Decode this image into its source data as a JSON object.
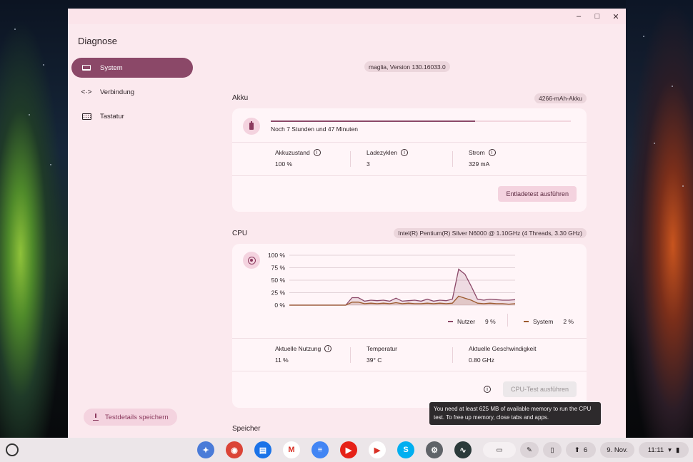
{
  "window": {
    "app_title": "Diagnose",
    "controls": {
      "minimize": "–",
      "maximize": "□",
      "close": "✕"
    }
  },
  "nav": {
    "items": [
      {
        "label": "System",
        "icon": "laptop-icon",
        "active": true
      },
      {
        "label": "Verbindung",
        "icon": "connection-icon",
        "active": false
      },
      {
        "label": "Tastatur",
        "icon": "keyboard-icon",
        "active": false
      }
    ],
    "save_label": "Testdetails speichern"
  },
  "version": "maglia, Version 130.16033.0",
  "battery": {
    "title": "Akku",
    "chip": "4266-mAh-Akku",
    "charge_fraction": 0.68,
    "remaining": "Noch 7 Stunden und 47 Minuten",
    "stats": [
      {
        "label": "Akkuzustand",
        "value": "100 %"
      },
      {
        "label": "Ladezyklen",
        "value": "3"
      },
      {
        "label": "Strom",
        "value": "329 mA"
      }
    ],
    "button": "Entladetest ausführen"
  },
  "cpu": {
    "title": "CPU",
    "chip": "Intel(R) Pentium(R) Silver N6000 @ 1.10GHz (4 Threads, 3.30 GHz)",
    "legend": [
      {
        "name": "Nutzer",
        "value": "9 %",
        "color": "#8b4868"
      },
      {
        "name": "System",
        "value": "2 %",
        "color": "#9c5a2e"
      }
    ],
    "stats": [
      {
        "label": "Aktuelle Nutzung",
        "value": "11 %"
      },
      {
        "label": "Temperatur",
        "value": "39° C"
      },
      {
        "label": "Aktuelle Geschwindigkeit",
        "value": "0.80 GHz"
      }
    ],
    "button": "CPU-Test ausführen",
    "tooltip": "You need at least 625 MB of available memory to run the CPU test. To free up memory, close tabs and apps."
  },
  "memory": {
    "title": "Speicher"
  },
  "chart_data": {
    "type": "area",
    "title": "",
    "xlabel": "",
    "ylabel": "",
    "ylim": [
      0,
      100
    ],
    "yticks": [
      "100 %",
      "75 %",
      "50 %",
      "25 %",
      "0 %"
    ],
    "x": [
      0,
      1,
      2,
      3,
      4,
      5,
      6,
      7,
      8,
      9,
      10,
      11,
      12,
      13,
      14,
      15,
      16,
      17,
      18,
      19,
      20,
      21,
      22,
      23,
      24,
      25,
      26,
      27,
      28,
      29,
      30,
      31,
      32,
      33,
      34,
      35,
      36
    ],
    "series": [
      {
        "name": "Nutzer",
        "color": "#8b4868",
        "values": [
          0,
          0,
          0,
          0,
          0,
          0,
          0,
          0,
          0,
          0,
          15,
          15,
          8,
          10,
          9,
          10,
          8,
          14,
          8,
          9,
          10,
          8,
          12,
          8,
          10,
          9,
          12,
          72,
          62,
          38,
          12,
          10,
          12,
          11,
          10,
          10,
          11
        ]
      },
      {
        "name": "System",
        "color": "#9c5a2e",
        "values": [
          0,
          0,
          0,
          0,
          0,
          0,
          0,
          0,
          0,
          0,
          6,
          6,
          3,
          4,
          3,
          4,
          3,
          5,
          3,
          4,
          3,
          3,
          4,
          3,
          4,
          3,
          4,
          18,
          14,
          10,
          4,
          3,
          4,
          3,
          3,
          2,
          3
        ]
      }
    ]
  },
  "shelf": {
    "date": "9. Nov.",
    "time": "11:11",
    "notifications": "6",
    "apps": [
      {
        "name": "gemini-icon",
        "color": "#4a7bd8",
        "glyph": "✦"
      },
      {
        "name": "chrome-icon",
        "color": "#db4437",
        "glyph": "◉"
      },
      {
        "name": "files-icon",
        "color": "#1a73e8",
        "glyph": "▤"
      },
      {
        "name": "gmail-icon",
        "color": "#ffffff",
        "glyph": "M"
      },
      {
        "name": "docs-icon",
        "color": "#4285f4",
        "glyph": "≡"
      },
      {
        "name": "youtube-icon",
        "color": "#e62117",
        "glyph": "▶"
      },
      {
        "name": "play-store-icon",
        "color": "#ffffff",
        "glyph": "▶"
      },
      {
        "name": "skype-icon",
        "color": "#00aff0",
        "glyph": "S"
      },
      {
        "name": "settings-icon",
        "color": "#5f6368",
        "glyph": "⚙"
      },
      {
        "name": "diagnostics-icon",
        "color": "#2b3a3a",
        "glyph": "∿"
      }
    ]
  }
}
